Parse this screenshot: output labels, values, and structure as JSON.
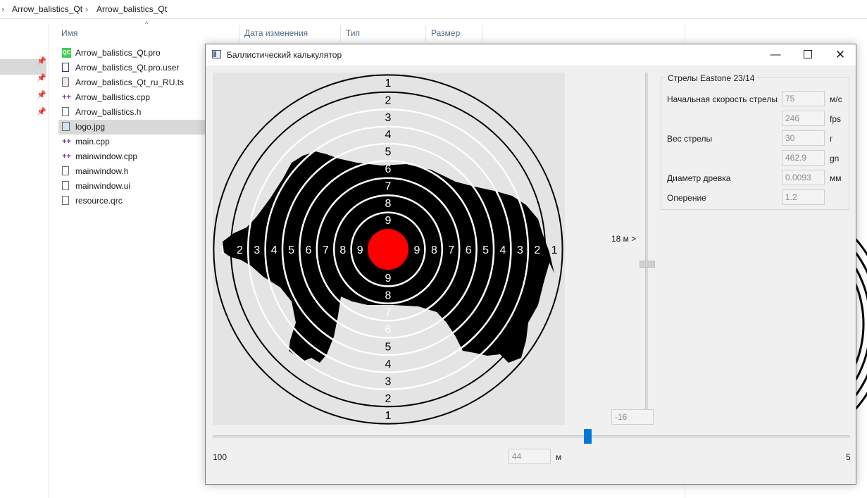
{
  "explorer": {
    "breadcrumb": [
      "Arrow_balistics_Qt",
      "Arrow_balistics_Qt"
    ],
    "columns": [
      "Имя",
      "Дата изменения",
      "Тип",
      "Размер"
    ],
    "files": [
      {
        "name": "Arrow_balistics_Qt.pro",
        "icon": "qt-project-icon"
      },
      {
        "name": "Arrow_balistics_Qt.pro.user",
        "icon": "user-file-icon"
      },
      {
        "name": "Arrow_balistics_Qt_ru_RU.ts",
        "icon": "translation-file-icon"
      },
      {
        "name": "Arrow_ballistics.cpp",
        "icon": "cpp-file-icon"
      },
      {
        "name": "Arrow_ballistics.h",
        "icon": "header-file-icon"
      },
      {
        "name": "logo.jpg",
        "icon": "image-file-icon",
        "selected": true
      },
      {
        "name": "main.cpp",
        "icon": "cpp-file-icon"
      },
      {
        "name": "mainwindow.cpp",
        "icon": "cpp-file-icon"
      },
      {
        "name": "mainwindow.h",
        "icon": "header-file-icon"
      },
      {
        "name": "mainwindow.ui",
        "icon": "ui-file-icon"
      },
      {
        "name": "resource.qrc",
        "icon": "resource-file-icon"
      }
    ]
  },
  "window": {
    "title": "Баллистический калькулятор",
    "buttons": {
      "minimize": "—",
      "maximize": "",
      "close": "✕"
    }
  },
  "target": {
    "ring_numbers_vertical_top": [
      "1",
      "2",
      "3",
      "4",
      "5",
      "6",
      "7",
      "8",
      "9"
    ],
    "ring_numbers_vertical_bottom": [
      "9",
      "8",
      "7",
      "6",
      "5",
      "4",
      "3",
      "2",
      "1"
    ],
    "ring_numbers_horizontal_left": [
      "1",
      "2",
      "3",
      "4",
      "5",
      "6",
      "7",
      "8",
      "9"
    ],
    "ring_numbers_horizontal_right": [
      "9",
      "8",
      "7",
      "6",
      "5",
      "4",
      "3",
      "2",
      "1"
    ],
    "bullseye_color": "#ff0000"
  },
  "vertical_slider": {
    "label": "18 м >",
    "value": "-16"
  },
  "arrows": {
    "group_title": "Стрелы Eastone 23/14",
    "speed_label": "Начальная скорость стрелы",
    "speed_ms": "75",
    "speed_ms_unit": "м/с",
    "speed_fps": "246",
    "speed_fps_unit": "fps",
    "weight_label": "Вес стрелы",
    "weight_g": "30",
    "weight_g_unit": "г",
    "weight_gn": "462.9",
    "weight_gn_unit": "gn",
    "diameter_label": "Диаметр древка",
    "diameter": "0.0093",
    "diameter_unit": "мм",
    "fletching_label": "Оперение",
    "fletching": "1.2"
  },
  "distance_slider": {
    "min_label": "100",
    "max_label": "5",
    "value": "44",
    "unit": "м",
    "fraction_from_left": 0.58
  }
}
